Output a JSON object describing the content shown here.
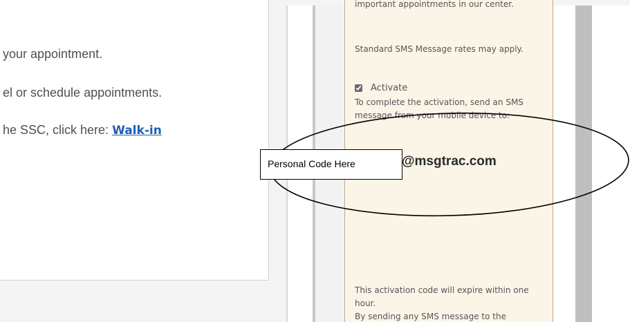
{
  "main": {
    "line1": "your appointment.",
    "line2": "el or schedule appointments.",
    "line3_prefix": "he SSC, click here: ",
    "walkin_label": "Walk-in"
  },
  "sms_panel": {
    "intro_tail": "important appointments in our center.",
    "rates_note": "Standard SMS Message rates may apply.",
    "activate_checked": true,
    "activate_label": "Activate",
    "instruction": "To complete the activation, send an SMS message from your mobile device to:",
    "address_domain": "@msgtrac.com",
    "expiry_note": "This activation code will expire within one hour.",
    "trailing_fragment": "By sending any SMS message to the"
  },
  "annotation": {
    "code_box_label": "Personal Code Here"
  },
  "colors": {
    "sms_panel_bg": "#fbf5e8",
    "sms_panel_border": "#c3a786",
    "link": "#1f5fb0"
  }
}
